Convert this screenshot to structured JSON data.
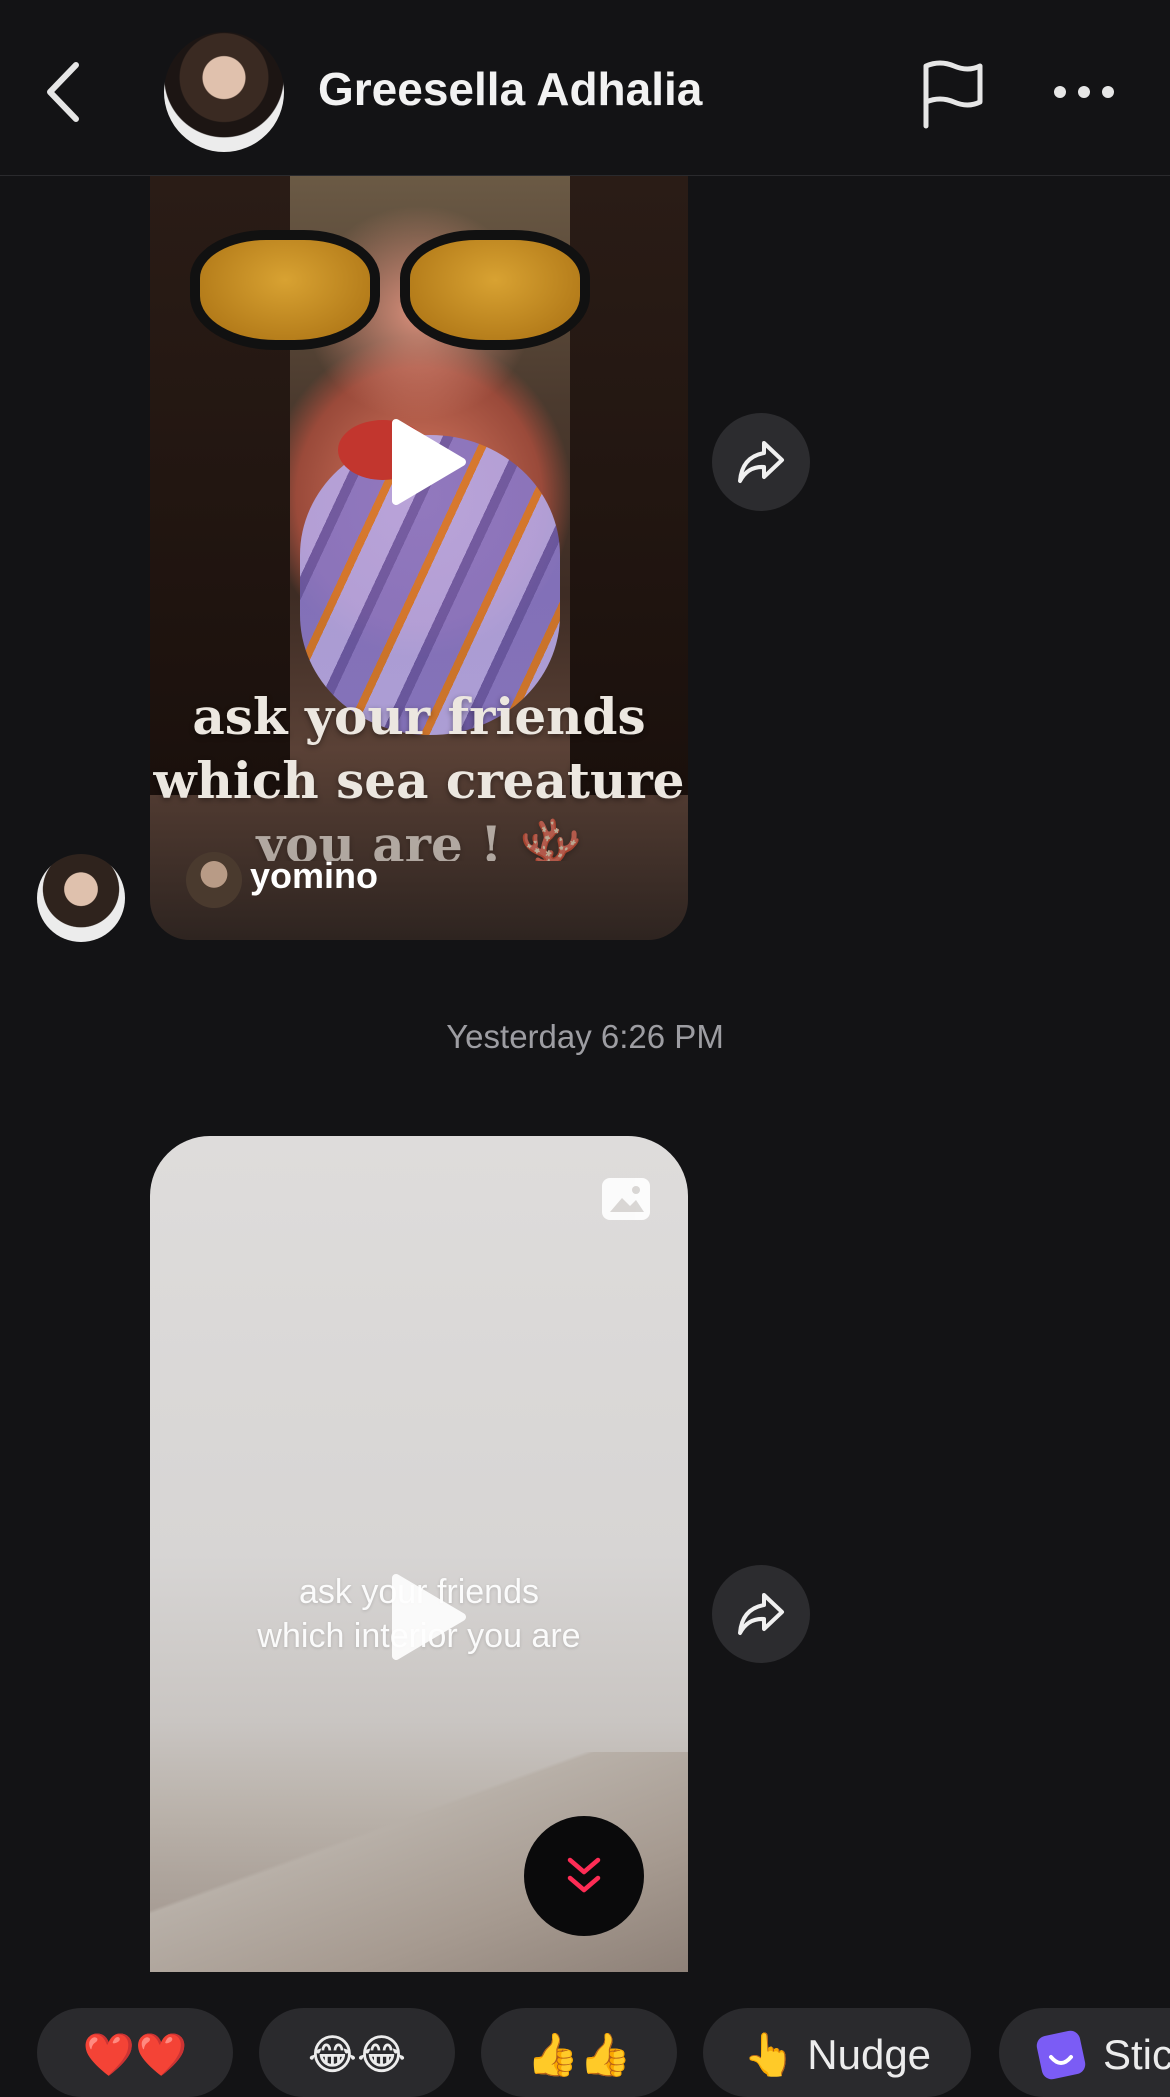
{
  "header": {
    "contact_name": "Greesella Adhalia"
  },
  "messages": [
    {
      "type": "shared-video",
      "overlay_caption_lines": [
        "ask your friends",
        "which sea creature",
        "you are ! 🪸"
      ],
      "creator_name": "yomino"
    },
    {
      "type": "timestamp",
      "text": "Yesterday 6:26 PM"
    },
    {
      "type": "shared-video",
      "overlay_caption_lines": [
        "ask your friends",
        "which interior you are"
      ]
    }
  ],
  "quick_replies": [
    {
      "label": "❤️❤️"
    },
    {
      "label": "😂😂"
    },
    {
      "label": "👍👍"
    },
    {
      "emoji": "👆",
      "label": "Nudge"
    },
    {
      "label": "Stic"
    }
  ],
  "colors": {
    "background": "#131315",
    "chip": "#2a2a2d",
    "accent_pink": "#fe2c55",
    "timestamp": "#9d9da2"
  },
  "icons": [
    "back-icon",
    "flag-icon",
    "more-icon",
    "play-icon",
    "share-icon",
    "scroll-down-icon",
    "image-icon",
    "sticker-icon"
  ]
}
